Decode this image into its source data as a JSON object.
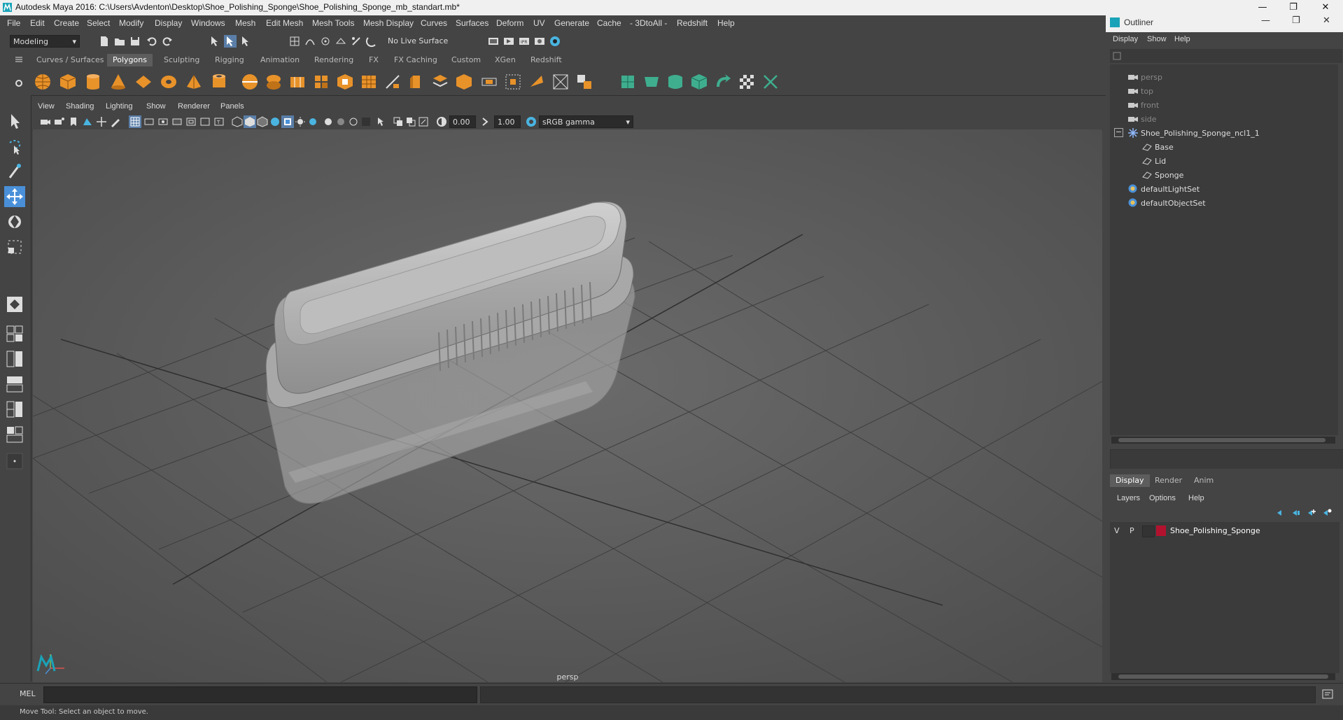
{
  "window": {
    "title": "Autodesk Maya 2016: C:\\Users\\Avdenton\\Desktop\\Shoe_Polishing_Sponge\\Shoe_Polishing_Sponge_mb_standart.mb*",
    "minimize": "—",
    "maximize": "❐",
    "close": "✕"
  },
  "menubar": [
    "File",
    "Edit",
    "Create",
    "Select",
    "Modify",
    "Display",
    "Windows",
    "Mesh",
    "Edit Mesh",
    "Mesh Tools",
    "Mesh Display",
    "Curves",
    "Surfaces",
    "Deform",
    "UV",
    "Generate",
    "Cache",
    "- 3DtoAll -",
    "Redshift",
    "Help"
  ],
  "statusline": {
    "mode": "Modeling",
    "live_surface": "No Live Surface"
  },
  "shelf_tabs": [
    "Curves / Surfaces",
    "Polygons",
    "Sculpting",
    "Rigging",
    "Animation",
    "Rendering",
    "FX",
    "FX Caching",
    "Custom",
    "XGen",
    "Redshift"
  ],
  "active_shelf_tab": "Polygons",
  "panel_menu": [
    "View",
    "Shading",
    "Lighting",
    "Show",
    "Renderer",
    "Panels"
  ],
  "panel_toolbar": {
    "exposure": "0.00",
    "gamma": "1.00",
    "color_space": "sRGB gamma"
  },
  "viewport": {
    "camera_label": "persp"
  },
  "outliner": {
    "title": "Outliner",
    "menu": [
      "Display",
      "Show",
      "Help"
    ],
    "items": [
      {
        "label": "persp",
        "type": "camera",
        "depth": 0
      },
      {
        "label": "top",
        "type": "camera",
        "depth": 0
      },
      {
        "label": "front",
        "type": "camera",
        "depth": 0
      },
      {
        "label": "side",
        "type": "camera",
        "depth": 0
      },
      {
        "label": "Shoe_Polishing_Sponge_ncl1_1",
        "type": "group",
        "depth": 0
      },
      {
        "label": "Base",
        "type": "mesh",
        "depth": 1
      },
      {
        "label": "Lid",
        "type": "mesh",
        "depth": 1
      },
      {
        "label": "Sponge",
        "type": "mesh",
        "depth": 1
      },
      {
        "label": "defaultLightSet",
        "type": "set",
        "depth": 0
      },
      {
        "label": "defaultObjectSet",
        "type": "set",
        "depth": 0
      }
    ],
    "collapse_symbol": "−"
  },
  "layer_editor": {
    "tabs": [
      "Display",
      "Render",
      "Anim"
    ],
    "active_tab": "Display",
    "menu": [
      "Layers",
      "Options",
      "Help"
    ],
    "layer": {
      "v": "V",
      "p": "P",
      "name": "Shoe_Polishing_Sponge",
      "color": "#b3122e"
    }
  },
  "command_line": {
    "language": "MEL"
  },
  "help_line": "Move Tool: Select an object to move.",
  "colors": {
    "shelf_orange": "#e8922a",
    "shelf_green": "#3fae8f",
    "active_tool": "#4a90d9"
  }
}
